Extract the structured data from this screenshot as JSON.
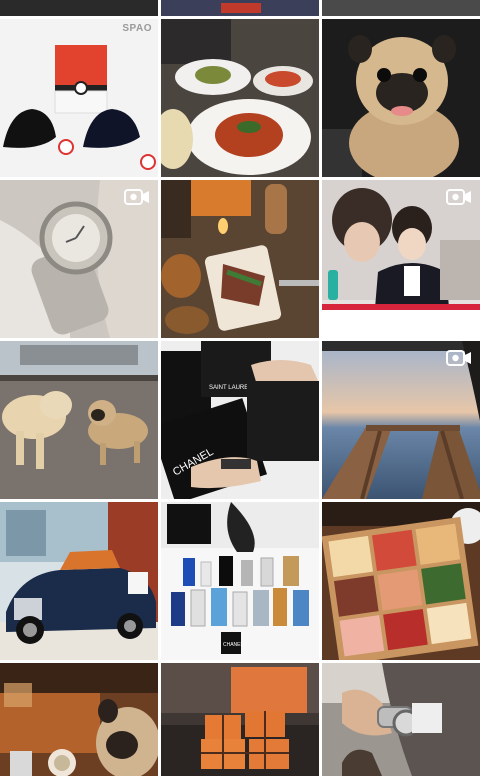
{
  "feed": {
    "brand_mark": "SPAO",
    "tiles": [
      {
        "subject": "pokeball-caps-box",
        "video": false
      },
      {
        "subject": "dinner-pasta-table",
        "video": false
      },
      {
        "subject": "pug-in-car",
        "video": false
      },
      {
        "subject": "wristwatch-closeup",
        "video": true
      },
      {
        "subject": "restaurant-plate-wine",
        "video": false
      },
      {
        "subject": "performer-tv-screen",
        "video": true
      },
      {
        "subject": "golden-retriever-and-pug",
        "video": false
      },
      {
        "subject": "shopping-bags-chanel-ysl",
        "video": false
      },
      {
        "subject": "sunset-sea-stairs",
        "video": true
      },
      {
        "subject": "rolls-royce-showroom",
        "video": false
      },
      {
        "subject": "fragrance-bottles-collection",
        "video": false
      },
      {
        "subject": "bento-box-sushi",
        "video": false
      },
      {
        "subject": "pug-at-table",
        "video": false
      },
      {
        "subject": "hermes-orange-boxes",
        "video": false
      },
      {
        "subject": "watch-bracelet-sleeve",
        "video": false
      }
    ]
  },
  "colors": {
    "divider": "#ffffff",
    "badge": "#ffffff"
  }
}
